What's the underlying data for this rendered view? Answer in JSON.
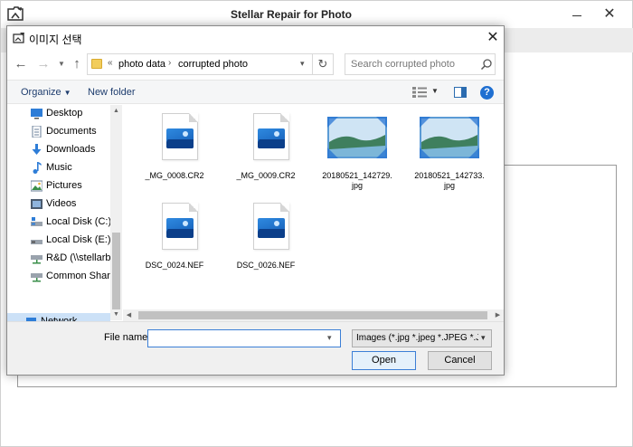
{
  "app": {
    "title": "Stellar Repair for Photo",
    "close_symbol": "✕"
  },
  "dialog": {
    "title": "이미지 선택",
    "close_symbol": "✕"
  },
  "address_bar": {
    "chevrons": "«",
    "breadcrumbs": [
      "photo data",
      "corrupted photo"
    ],
    "separator": "›"
  },
  "search": {
    "placeholder": "Search corrupted photo"
  },
  "command_bar": {
    "organize_label": "Organize",
    "new_folder_label": "New folder"
  },
  "nav_pane": {
    "items": [
      {
        "label": "Desktop",
        "icon": "desktop-icon"
      },
      {
        "label": "Documents",
        "icon": "documents-icon"
      },
      {
        "label": "Downloads",
        "icon": "downloads-icon"
      },
      {
        "label": "Music",
        "icon": "music-icon"
      },
      {
        "label": "Pictures",
        "icon": "pictures-icon"
      },
      {
        "label": "Videos",
        "icon": "videos-icon"
      },
      {
        "label": "Local Disk (C:)",
        "icon": "drive-icon"
      },
      {
        "label": "Local Disk (E:)",
        "icon": "drive-icon"
      },
      {
        "label": "R&D (\\\\stellarba",
        "icon": "network-drive-icon"
      },
      {
        "label": "Common Share",
        "icon": "network-drive-icon"
      },
      {
        "label": "Network",
        "icon": "network-icon",
        "selected": true
      }
    ]
  },
  "files": [
    {
      "name": "_MG_0008.CR2",
      "type": "raw-image"
    },
    {
      "name": "_MG_0009.CR2",
      "type": "raw-image"
    },
    {
      "name": "20180521_142729.jpg",
      "type": "photo"
    },
    {
      "name": "20180521_142733.jpg",
      "type": "photo"
    },
    {
      "name": "DSC_0024.NEF",
      "type": "raw-image"
    },
    {
      "name": "DSC_0026.NEF",
      "type": "raw-image"
    }
  ],
  "file_labels": {
    "f0": "_MG_0008.CR2",
    "f1": "_MG_0009.CR2",
    "f2": "20180521_142729.\njpg",
    "f3": "20180521_142733.\njpg",
    "f4": "DSC_0024.NEF",
    "f5": "DSC_0026.NEF"
  },
  "bottom": {
    "filename_label": "File name:",
    "filename_value": "",
    "filetype_selected": "Images (*.jpg *.jpeg *.JPEG *.JPG",
    "open_label": "Open",
    "cancel_label": "Cancel"
  },
  "colors": {
    "accent": "#1f6fd1",
    "selection": "#cce1f7",
    "link_text": "#1e3d6e"
  }
}
